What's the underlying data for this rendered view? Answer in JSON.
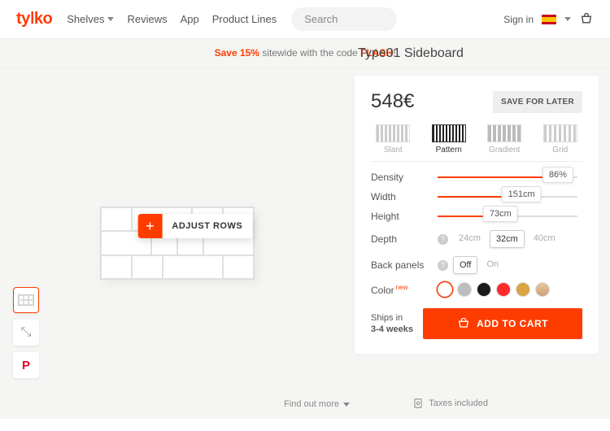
{
  "header": {
    "logo": "tylko",
    "nav": {
      "shelves": "Shelves",
      "reviews": "Reviews",
      "app": "App",
      "product_lines": "Product Lines"
    },
    "search_placeholder": "Search",
    "sign_in": "Sign in"
  },
  "promo": {
    "prefix": "Save 15%",
    "middle": " sitewide with the code ",
    "code": "FLASH",
    "suffix": "!"
  },
  "viewer": {
    "adjust_label": "ADJUST ROWS",
    "find_more": "Find out more"
  },
  "product": {
    "title": "Type01 Sideboard",
    "price": "548€",
    "save_later": "SAVE FOR LATER",
    "styles": {
      "slant": "Slant",
      "pattern": "Pattern",
      "gradient": "Gradient",
      "grid": "Grid"
    },
    "density": {
      "label": "Density",
      "value": "86%"
    },
    "width": {
      "label": "Width",
      "value": "151cm"
    },
    "height": {
      "label": "Height",
      "value": "73cm"
    },
    "depth": {
      "label": "Depth",
      "options": [
        "24cm",
        "32cm",
        "40cm"
      ],
      "selected": "32cm"
    },
    "back": {
      "label": "Back panels",
      "options": [
        "Off",
        "On"
      ],
      "selected": "Off"
    },
    "color": {
      "label": "Color",
      "badge": "new",
      "options": [
        "#ffffff",
        "#bdbdbd",
        "#1a1a1a",
        "#ff2a2a",
        "#d9a441",
        "#e4c7a0"
      ],
      "selected": "#ffffff"
    },
    "ships_label": "Ships in",
    "ships_value": "3-4 weeks",
    "add_to_cart": "ADD TO CART"
  },
  "footer": {
    "taxes": "Taxes included"
  }
}
